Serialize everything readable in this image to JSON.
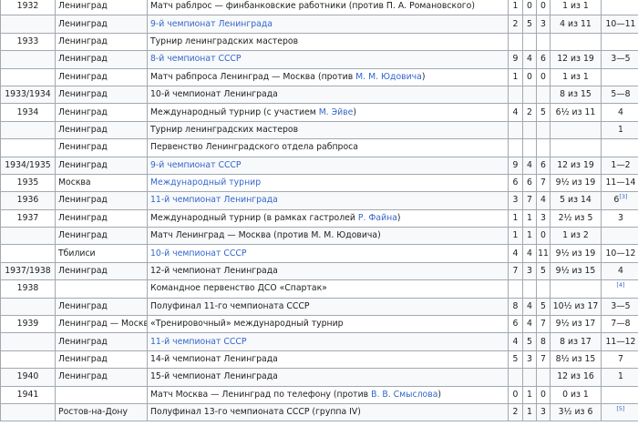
{
  "rows": [
    {
      "year": "1932",
      "city": "Ленинград",
      "event": [
        {
          "t": "Матч раблрос — финбанковские работники (против П. А. Романовского)"
        }
      ],
      "w": "1",
      "d": "0",
      "l": "0",
      "score": "1 из 1",
      "place": "",
      "ref": ""
    },
    {
      "year": "",
      "city": "Ленинград",
      "event": [
        {
          "t": "9-й чемпионат Ленинграда",
          "link": true
        }
      ],
      "w": "2",
      "d": "5",
      "l": "3",
      "score": "4 из 11",
      "place": "10—11",
      "ref": ""
    },
    {
      "year": "1933",
      "city": "Ленинград",
      "event": [
        {
          "t": "Турнир ленинградских мастеров"
        }
      ],
      "w": "",
      "d": "",
      "l": "",
      "score": "",
      "place": "",
      "ref": ""
    },
    {
      "year": "",
      "city": "Ленинград",
      "event": [
        {
          "t": "8-й чемпионат СССР",
          "link": true
        }
      ],
      "w": "9",
      "d": "4",
      "l": "6",
      "score": "12 из 19",
      "place": "3—5",
      "ref": ""
    },
    {
      "year": "",
      "city": "Ленинград",
      "event": [
        {
          "t": "Матч рабпроса Ленинград — Москва (против "
        },
        {
          "t": "М. М. Юдовича",
          "link": true
        },
        {
          "t": ")"
        }
      ],
      "w": "1",
      "d": "0",
      "l": "0",
      "score": "1 из 1",
      "place": "",
      "ref": ""
    },
    {
      "year": "1933/1934",
      "city": "Ленинград",
      "event": [
        {
          "t": "10-й чемпионат Ленинграда"
        }
      ],
      "w": "",
      "d": "",
      "l": "",
      "score": "8 из 15",
      "place": "5—8",
      "ref": ""
    },
    {
      "year": "1934",
      "city": "Ленинград",
      "event": [
        {
          "t": "Международный турнир (с участием "
        },
        {
          "t": "М. Эйве",
          "link": true
        },
        {
          "t": ")"
        }
      ],
      "w": "4",
      "d": "2",
      "l": "5",
      "score": "6½ из 11",
      "place": "4",
      "ref": ""
    },
    {
      "year": "",
      "city": "Ленинград",
      "event": [
        {
          "t": "Турнир ленинградских мастеров"
        }
      ],
      "w": "",
      "d": "",
      "l": "",
      "score": "",
      "place": "1",
      "ref": ""
    },
    {
      "year": "",
      "city": "Ленинград",
      "event": [
        {
          "t": "Первенство Ленинградского отдела рабпроса"
        }
      ],
      "w": "",
      "d": "",
      "l": "",
      "score": "",
      "place": "",
      "ref": ""
    },
    {
      "year": "1934/1935",
      "city": "Ленинград",
      "event": [
        {
          "t": "9-й чемпионат СССР",
          "link": true
        }
      ],
      "w": "9",
      "d": "4",
      "l": "6",
      "score": "12 из 19",
      "place": "1—2",
      "ref": ""
    },
    {
      "year": "1935",
      "city": "Москва",
      "event": [
        {
          "t": "Международный турнир",
          "link": true
        }
      ],
      "w": "6",
      "d": "6",
      "l": "7",
      "score": "9½ из 19",
      "place": "11—14",
      "ref": ""
    },
    {
      "year": "1936",
      "city": "Ленинград",
      "event": [
        {
          "t": "11-й чемпионат Ленинграда",
          "link": true
        }
      ],
      "w": "3",
      "d": "7",
      "l": "4",
      "score": "5 из 14",
      "place": "6",
      "ref": "[3]"
    },
    {
      "year": "1937",
      "city": "Ленинград",
      "event": [
        {
          "t": "Международный турнир (в рамках гастролей "
        },
        {
          "t": "Р. Файна",
          "link": true
        },
        {
          "t": ")"
        }
      ],
      "w": "1",
      "d": "1",
      "l": "3",
      "score": "2½ из 5",
      "place": "3",
      "ref": ""
    },
    {
      "year": "",
      "city": "Ленинград",
      "event": [
        {
          "t": "Матч Ленинград — Москва (против М. М. Юдовича)"
        }
      ],
      "w": "1",
      "d": "1",
      "l": "0",
      "score": "1 из 2",
      "place": "",
      "ref": ""
    },
    {
      "year": "",
      "city": "Тбилиси",
      "event": [
        {
          "t": "10-й чемпионат СССР",
          "link": true
        }
      ],
      "w": "4",
      "d": "4",
      "l": "11",
      "score": "9½ из 19",
      "place": "10—12",
      "ref": ""
    },
    {
      "year": "1937/1938",
      "city": "Ленинград",
      "event": [
        {
          "t": "12-й чемпионат Ленинграда"
        }
      ],
      "w": "7",
      "d": "3",
      "l": "5",
      "score": "9½ из 15",
      "place": "4",
      "ref": ""
    },
    {
      "year": "1938",
      "city": "",
      "event": [
        {
          "t": "Командное первенство ДСО «Спартак»"
        }
      ],
      "w": "",
      "d": "",
      "l": "",
      "score": "",
      "place": "",
      "ref": "[4]"
    },
    {
      "year": "",
      "city": "Ленинград",
      "event": [
        {
          "t": "Полуфинал 11-го чемпионата СССР"
        }
      ],
      "w": "8",
      "d": "4",
      "l": "5",
      "score": "10½ из 17",
      "place": "3—5",
      "ref": ""
    },
    {
      "year": "1939",
      "city": "Ленинград — Москва",
      "event": [
        {
          "t": "«Тренировочный» международный турнир"
        }
      ],
      "w": "6",
      "d": "4",
      "l": "7",
      "score": "9½ из 17",
      "place": "7—8",
      "ref": ""
    },
    {
      "year": "",
      "city": "Ленинград",
      "event": [
        {
          "t": "11-й чемпионат СССР",
          "link": true
        }
      ],
      "w": "4",
      "d": "5",
      "l": "8",
      "score": "8 из 17",
      "place": "11—12",
      "ref": ""
    },
    {
      "year": "",
      "city": "Ленинград",
      "event": [
        {
          "t": "14-й чемпионат Ленинграда"
        }
      ],
      "w": "5",
      "d": "3",
      "l": "7",
      "score": "8½ из 15",
      "place": "7",
      "ref": ""
    },
    {
      "year": "1940",
      "city": "Ленинград",
      "event": [
        {
          "t": "15-й чемпионат Ленинграда"
        }
      ],
      "w": "",
      "d": "",
      "l": "",
      "score": "12 из 16",
      "place": "1",
      "ref": ""
    },
    {
      "year": "1941",
      "city": "",
      "event": [
        {
          "t": "Матч Москва — Ленинград по телефону (против "
        },
        {
          "t": "В. В. Смыслова",
          "link": true
        },
        {
          "t": ")"
        }
      ],
      "w": "0",
      "d": "1",
      "l": "0",
      "score": "0 из 1",
      "place": "",
      "ref": ""
    },
    {
      "year": "",
      "city": "Ростов-на-Дону",
      "event": [
        {
          "t": "Полуфинал 13-го чемпионата СССР (группа IV)"
        }
      ],
      "w": "2",
      "d": "1",
      "l": "3",
      "score": "3½ из 6",
      "place": "",
      "ref": "[5]"
    }
  ]
}
